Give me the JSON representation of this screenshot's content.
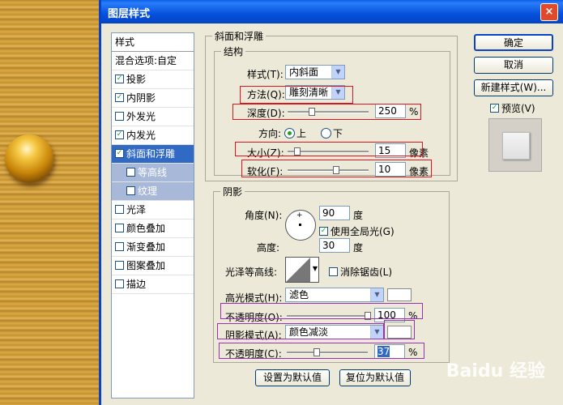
{
  "window": {
    "title": "图层样式",
    "close": "×"
  },
  "styles_list": {
    "header": "样式",
    "items": [
      {
        "label": "混合选项:自定",
        "checked": null
      },
      {
        "label": "投影",
        "checked": true
      },
      {
        "label": "内阴影",
        "checked": true
      },
      {
        "label": "外发光",
        "checked": false
      },
      {
        "label": "内发光",
        "checked": true
      },
      {
        "label": "斜面和浮雕",
        "checked": true,
        "selected": true
      },
      {
        "label": "等高线",
        "checked": false,
        "sub": true
      },
      {
        "label": "纹理",
        "checked": false,
        "sub": true
      },
      {
        "label": "光泽",
        "checked": false
      },
      {
        "label": "颜色叠加",
        "checked": false
      },
      {
        "label": "渐变叠加",
        "checked": false
      },
      {
        "label": "图案叠加",
        "checked": false
      },
      {
        "label": "描边",
        "checked": false
      }
    ]
  },
  "bevel": {
    "section_title": "斜面和浮雕",
    "structure_title": "结构",
    "style_label": "样式(T):",
    "style_value": "内斜面",
    "technique_label": "方法(Q):",
    "technique_value": "雕刻清晰",
    "depth_label": "深度(D):",
    "depth_value": "250",
    "depth_unit": "%",
    "depth_slider": 0.3,
    "direction_label": "方向:",
    "direction_up": "上",
    "direction_down": "下",
    "direction_selected": "上",
    "size_label": "大小(Z):",
    "size_value": "15",
    "size_unit": "像素",
    "size_slider": 0.12,
    "soften_label": "软化(F):",
    "soften_value": "10",
    "soften_unit": "像素",
    "soften_slider": 0.6
  },
  "shading": {
    "title": "阴影",
    "angle_label": "角度(N):",
    "angle_value": "90",
    "angle_unit": "度",
    "global_light_label": "使用全局光(G)",
    "global_light_checked": true,
    "altitude_label": "高度:",
    "altitude_value": "30",
    "altitude_unit": "度",
    "gloss_label": "光泽等高线:",
    "antialias_label": "消除锯齿(L)",
    "antialias_checked": false,
    "highlight_mode_label": "高光模式(H):",
    "highlight_mode_value": "滤色",
    "highlight_opacity_label": "不透明度(O):",
    "highlight_opacity_value": "100",
    "highlight_opacity_unit": "%",
    "highlight_opacity_slider": 1.0,
    "shadow_mode_label": "阴影模式(A):",
    "shadow_mode_value": "颜色减淡",
    "shadow_opacity_label": "不透明度(C):",
    "shadow_opacity_value": "37",
    "shadow_opacity_unit": "%",
    "shadow_opacity_slider": 0.37
  },
  "buttons": {
    "ok": "确定",
    "cancel": "取消",
    "new_style": "新建样式(W)...",
    "preview_label": "预览(V)",
    "set_default": "设置为默认值",
    "reset_default": "复位为默认值"
  },
  "watermark": "Baidu 经验"
}
